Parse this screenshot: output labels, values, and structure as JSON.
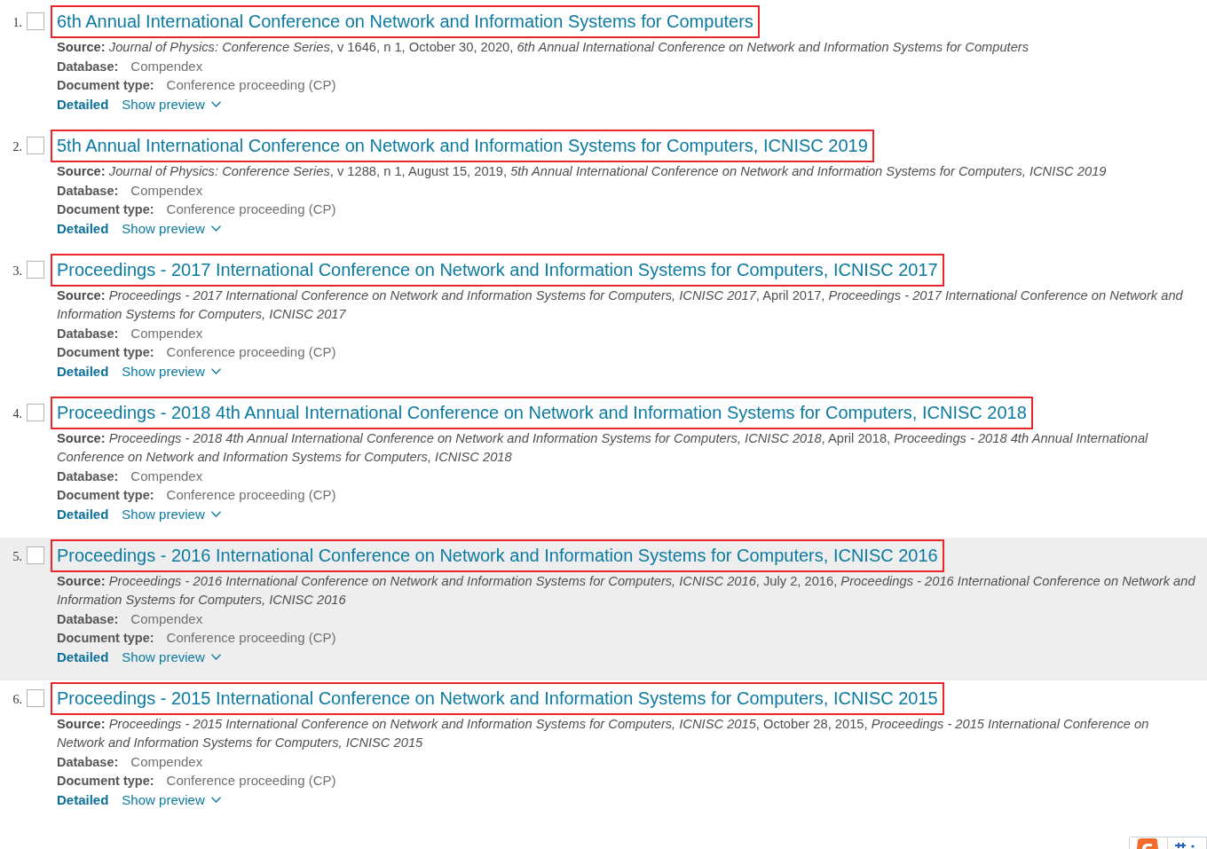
{
  "results": [
    {
      "number": "1.",
      "checked": false,
      "hovered": false,
      "highlighted": true,
      "title": "6th Annual International Conference on Network and Information Systems for Computers",
      "source": "**Source:** *Journal of Physics: Conference Series*, v 1646, n 1, October 30, 2020, *6th Annual International Conference on Network and Information Systems for Computers*",
      "database_label": "Database:",
      "database": "Compendex",
      "document_type_label": "Document type:",
      "document_type": "Conference proceeding (CP)",
      "links": [
        {
          "kind": "detail",
          "label": "Detailed"
        },
        {
          "kind": "preview",
          "label": "Show preview",
          "expanded": false
        }
      ]
    },
    {
      "number": "2.",
      "checked": false,
      "hovered": false,
      "highlighted": true,
      "title": "5th Annual International Conference on Network and Information Systems for Computers, ICNISC 2019",
      "source": "**Source:** *Journal of Physics: Conference Series*, v 1288, n 1, August 15, 2019, *5th Annual International Conference on Network and Information Systems for Computers, ICNISC 2019*",
      "database_label": "Database:",
      "database": "Compendex",
      "document_type_label": "Document type:",
      "document_type": "Conference proceeding (CP)",
      "links": [
        {
          "kind": "detail",
          "label": "Detailed"
        },
        {
          "kind": "preview",
          "label": "Show preview",
          "expanded": false
        }
      ]
    },
    {
      "number": "3.",
      "checked": false,
      "hovered": false,
      "highlighted": true,
      "title": "Proceedings - 2017 International Conference on Network and Information Systems for Computers, ICNISC 2017",
      "source": "**Source:** *Proceedings - 2017 International Conference on Network and Information Systems for Computers, ICNISC 2017*, April 2017, *Proceedings - 2017 International Conference on Network and Information Systems for Computers, ICNISC 2017*",
      "database_label": "Database:",
      "database": "Compendex",
      "document_type_label": "Document type:",
      "document_type": "Conference proceeding (CP)",
      "links": [
        {
          "kind": "detail",
          "label": "Detailed"
        },
        {
          "kind": "preview",
          "label": "Show preview",
          "expanded": false
        }
      ]
    },
    {
      "number": "4.",
      "checked": false,
      "hovered": false,
      "highlighted": true,
      "title": "Proceedings - 2018 4th Annual International Conference on Network and Information Systems for Computers, ICNISC 2018",
      "source": "**Source:** *Proceedings - 2018 4th Annual International Conference on Network and Information Systems for Computers, ICNISC 2018*, April 2018, *Proceedings - 2018 4th Annual International Conference on Network and Information Systems for Computers, ICNISC 2018*",
      "database_label": "Database:",
      "database": "Compendex",
      "document_type_label": "Document type:",
      "document_type": "Conference proceeding (CP)",
      "links": [
        {
          "kind": "detail",
          "label": "Detailed"
        },
        {
          "kind": "preview",
          "label": "Show preview",
          "expanded": false
        }
      ]
    },
    {
      "number": "5.",
      "checked": false,
      "hovered": true,
      "highlighted": true,
      "title": "Proceedings - 2016 International Conference on Network and Information Systems for Computers, ICNISC 2016",
      "source": "**Source:** *Proceedings - 2016 International Conference on Network and Information Systems for Computers, ICNISC 2016*, July 2, 2016, *Proceedings - 2016 International Conference on Network and Information Systems for Computers, ICNISC 2016*",
      "database_label": "Database:",
      "database": "Compendex",
      "document_type_label": "Document type:",
      "document_type": "Conference proceeding (CP)",
      "links": [
        {
          "kind": "detail",
          "label": "Detailed"
        },
        {
          "kind": "preview",
          "label": "Show preview",
          "expanded": false
        }
      ]
    },
    {
      "number": "6.",
      "checked": false,
      "hovered": false,
      "highlighted": true,
      "title": "Proceedings - 2015 International Conference on Network and Information Systems for Computers, ICNISC 2015",
      "source": "**Source:** *Proceedings - 2015 International Conference on Network and Information Systems for Computers, ICNISC 2015*, October 28, 2015, *Proceedings - 2015 International Conference on Network and Information Systems for Computers, ICNISC 2015*",
      "database_label": "Database:",
      "database": "Compendex",
      "document_type_label": "Document type:",
      "document_type": "Conference proceeding (CP)",
      "links": [
        {
          "kind": "detail",
          "label": "Detailed"
        },
        {
          "kind": "preview",
          "label": "Show preview",
          "expanded": false
        }
      ]
    }
  ]
}
